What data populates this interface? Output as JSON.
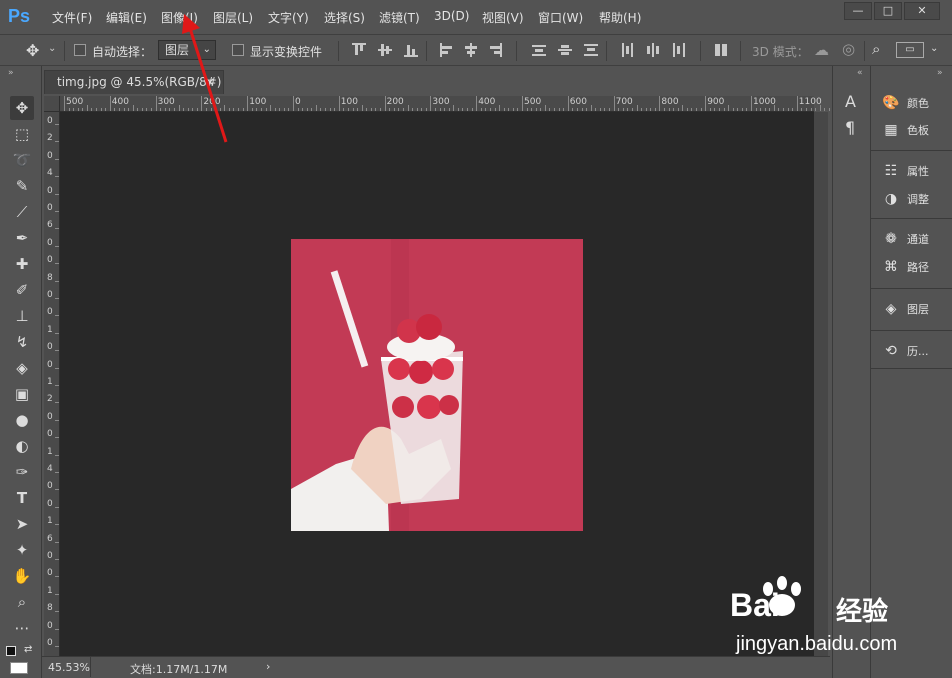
{
  "app": {
    "logo": "Ps"
  },
  "menu": [
    "文件(F)",
    "编辑(E)",
    "图像(I)",
    "图层(L)",
    "文字(Y)",
    "选择(S)",
    "滤镜(T)",
    "3D(D)",
    "视图(V)",
    "窗口(W)",
    "帮助(H)"
  ],
  "options": {
    "auto_select_label": "自动选择：",
    "layer_select": "图层",
    "show_transform": "显示变换控件",
    "mode_3d": "3D 模式："
  },
  "document": {
    "tab_title": "timg.jpg @ 45.5%(RGB/8#)",
    "close": "×"
  },
  "ruler": {
    "h_labels": [
      "500",
      "400",
      "300",
      "200",
      "100",
      "0",
      "100",
      "200",
      "300",
      "400",
      "500",
      "600",
      "700",
      "800",
      "900",
      "1000",
      "1100"
    ],
    "v_labels": [
      "0",
      "2",
      "0",
      "4",
      "0",
      "0",
      "6",
      "0",
      "0",
      "8",
      "0",
      "0",
      "1",
      "0",
      "0",
      "1",
      "2",
      "0",
      "0",
      "1",
      "4",
      "0",
      "0",
      "1",
      "6",
      "0",
      "0",
      "1",
      "8",
      "0",
      "0"
    ]
  },
  "status": {
    "zoom": "45.53%",
    "doc_info": "文档:1.17M/1.17M",
    "arrow": "›"
  },
  "panels": [
    {
      "icon": "palette-icon",
      "label": "颜色"
    },
    {
      "icon": "swatches-icon",
      "label": "色板"
    },
    {
      "icon": "properties-icon",
      "label": "属性"
    },
    {
      "icon": "adjustments-icon",
      "label": "调整"
    },
    {
      "icon": "channels-icon",
      "label": "通道"
    },
    {
      "icon": "paths-icon",
      "label": "路径"
    },
    {
      "icon": "layers-icon",
      "label": "图层"
    },
    {
      "icon": "history-icon",
      "label": "历..."
    }
  ],
  "mini_panel": {
    "char": "A",
    "para": "¶"
  },
  "watermark": {
    "brand": "Bai",
    "brand2": "经验",
    "url": "jingyan.baidu.com"
  },
  "colors": {
    "accent": "#4aa8ff",
    "canvas": "#282828",
    "photo_bg": "#c23a55",
    "arrow": "#e01818"
  }
}
